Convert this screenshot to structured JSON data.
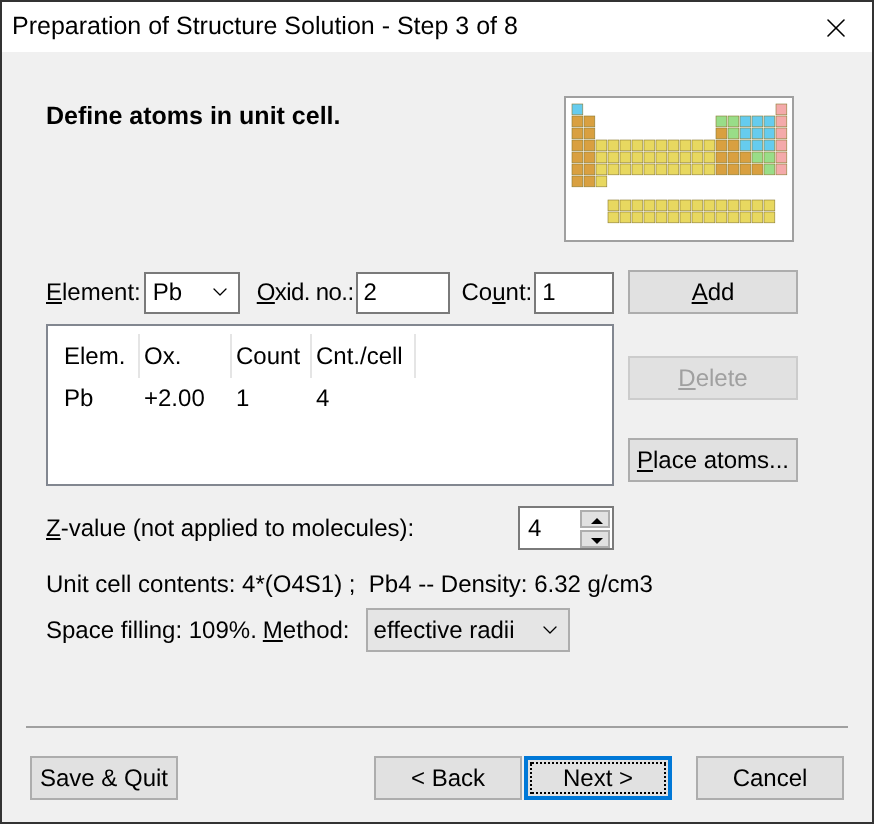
{
  "window": {
    "title": "Preparation of Structure Solution - Step 3 of 8"
  },
  "heading": "Define atoms in unit cell.",
  "element": {
    "label": {
      "key": "E",
      "post": "lement:"
    },
    "value": "Pb"
  },
  "oxid": {
    "label": {
      "key": "O",
      "post": "xid. no.:"
    },
    "value": "2"
  },
  "count": {
    "label": {
      "pre": "Co",
      "key": "u",
      "post": "nt:"
    },
    "value": "1"
  },
  "side_buttons": [
    {
      "label": {
        "key": "A",
        "post": "dd"
      },
      "disabled": false
    },
    {
      "label": {
        "key": "D",
        "post": "elete"
      },
      "disabled": true
    },
    {
      "label": {
        "key": "P",
        "post": "lace atoms..."
      },
      "disabled": false
    }
  ],
  "table": {
    "columns": [
      "Elem.",
      "Ox.",
      "Count",
      "Cnt./cell"
    ],
    "rows": [
      [
        "Pb",
        "+2.00",
        "1",
        "4"
      ]
    ]
  },
  "z_value": {
    "label": {
      "key": "Z",
      "post": "-value (not applied to molecules):"
    },
    "value": "4"
  },
  "contents": "Unit cell contents: 4*(O4S1) ;  Pb4 -- Density: 6.32 g/cm3",
  "space_filling": "Space filling: 109%.",
  "method": {
    "label": {
      "key": "M",
      "post": "ethod:"
    },
    "value": "effective radii"
  },
  "footer_buttons": [
    {
      "label": "Save & Quit",
      "default": false
    },
    {
      "label": "< Back",
      "default": false
    },
    {
      "label": "Next >",
      "default": true
    },
    {
      "label": "Cancel",
      "default": false
    }
  ]
}
